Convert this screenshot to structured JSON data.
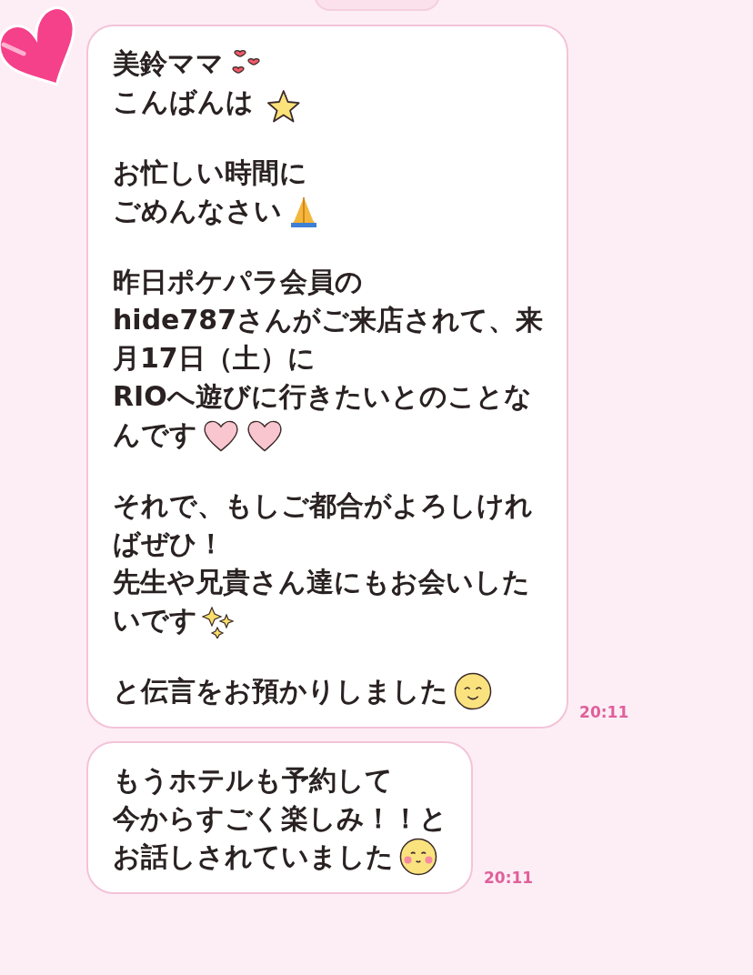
{
  "messages": [
    {
      "time": "20:11",
      "avatar": true,
      "paragraphs": [
        [
          {
            "text": "美鈴ママ",
            "stickers": [
              {
                "kind": "hearts"
              }
            ]
          },
          {
            "text": "こんばんは",
            "stickers": [
              {
                "kind": "star"
              }
            ]
          }
        ],
        [
          {
            "text": "お忙しい時間に"
          },
          {
            "text": "ごめんなさい",
            "stickers": [
              {
                "kind": "pray"
              }
            ]
          }
        ],
        [
          {
            "text": "昨日ポケパラ会員の"
          },
          {
            "text": "hide787さんがご来店されて、来"
          },
          {
            "text": "月17日（土）に"
          },
          {
            "text": "RIOへ遊びに行きたいとのことな"
          },
          {
            "text": "んです",
            "stickers": [
              {
                "kind": "pinkheart"
              },
              {
                "kind": "pinkheart"
              }
            ]
          }
        ],
        [
          {
            "text": "それで、もしご都合がよろしけれ"
          },
          {
            "text": "ばぜひ！"
          },
          {
            "text": "先生や兄貴さん達にもお会いした"
          },
          {
            "text": "いです",
            "stickers": [
              {
                "kind": "sparkles"
              }
            ]
          }
        ],
        [
          {
            "text": "と伝言をお預かりしました",
            "stickers": [
              {
                "kind": "smile"
              }
            ]
          }
        ]
      ]
    },
    {
      "time": "20:11",
      "avatar": false,
      "paragraphs": [
        [
          {
            "text": "もうホテルも予約して"
          },
          {
            "text": "今からすごく楽しみ！！と"
          },
          {
            "text": "お話しされていました",
            "stickers": [
              {
                "kind": "blush"
              }
            ]
          }
        ]
      ]
    }
  ]
}
